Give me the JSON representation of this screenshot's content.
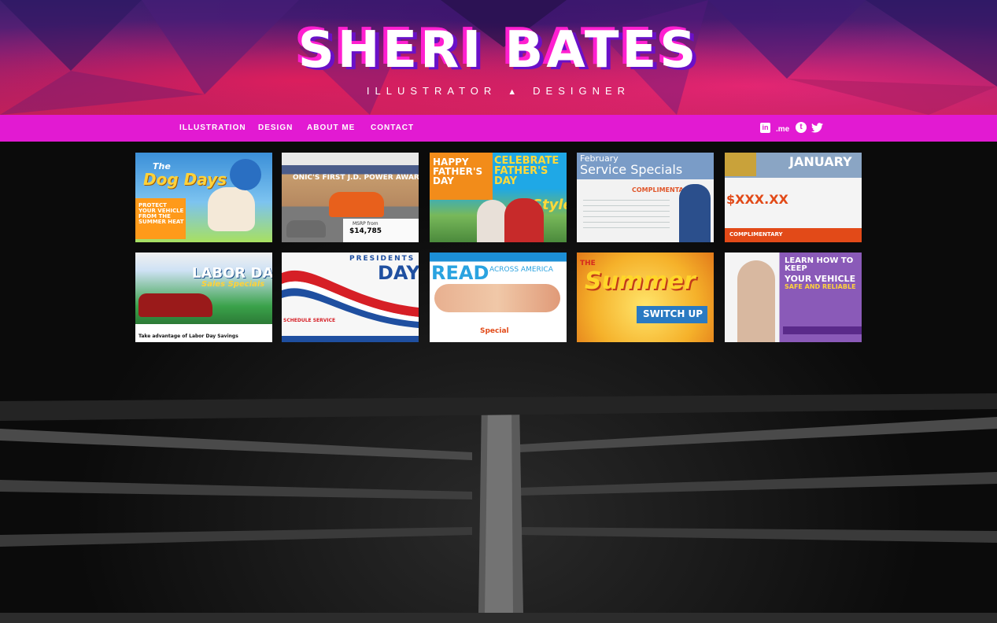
{
  "site": {
    "title": "SHERI BATES",
    "tagline_left": "ILLUSTRATOR",
    "tagline_symbol": "▲",
    "tagline_right": "DESIGNER"
  },
  "nav": {
    "items": [
      "ILLUSTRATION",
      "DESIGN",
      "ABOUT ME",
      "CONTACT"
    ]
  },
  "social": {
    "linkedin_icon": "linkedin-icon",
    "aboutme_label": ".me",
    "tumblr_icon": "tumblr-icon",
    "twitter_icon": "twitter-icon"
  },
  "colors": {
    "nav_bg": "#e21ad2",
    "logo_shadow_pink": "#ff1fd0",
    "logo_shadow_purple": "#6a10c8"
  },
  "gallery": [
    {
      "line1": "The",
      "line2": "Dog Days",
      "line3": "PROTECT YOUR VEHICLE FROM THE SUMMER HEAT"
    },
    {
      "line1": "ONIC'S FIRST J.D. POWER AWARD",
      "line2": "$14,785",
      "line3": "MSRP from"
    },
    {
      "line1": "HAPPY FATHER'S DAY",
      "line2": "CELEBRATE FATHER'S DAY",
      "line3": "Style"
    },
    {
      "line1": "February",
      "line2": "Service Specials",
      "line3": "COMPLIMENTARY"
    },
    {
      "line1": "JANUARY",
      "line2": "$XXX.XX",
      "line3": "COMPLIMENTARY"
    },
    {
      "line1": "LABOR DAY",
      "line2": "Sales Specials",
      "line3": "Take advantage of Labor Day Savings"
    },
    {
      "line1": "PRESIDENTS",
      "line2": "DAY",
      "line3": "SCHEDULE SERVICE"
    },
    {
      "line1": "READ",
      "line2": "ACROSS AMERICA",
      "line3": "Special"
    },
    {
      "line1": "THE",
      "line2": "Summer",
      "line3": "SWITCH UP"
    },
    {
      "line1": "LEARN HOW TO KEEP",
      "line2": "YOUR VEHICLE",
      "line3": "SAFE AND RELIABLE"
    }
  ]
}
